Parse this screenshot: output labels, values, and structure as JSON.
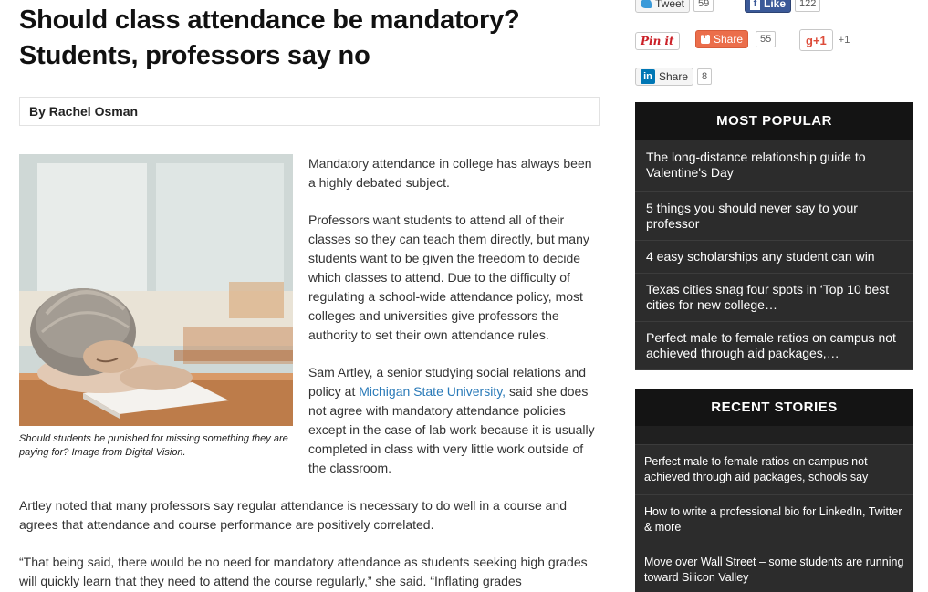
{
  "article": {
    "headline": "Should class attendance be mandatory? Students, professors say no",
    "byline": "By Rachel Osman",
    "image_caption": "Should students be punished for missing something they are paying for? Image from Digital Vision.",
    "paragraphs": {
      "p1": "Mandatory attendance in college has always been a highly debated subject.",
      "p2": "Professors want students to attend all of their classes so they can teach them directly, but many students want to be given the freedom to decide which classes to attend. Due to the difficulty of regulating a school-wide attendance policy, most colleges and universities give professors the authority to set their own attendance rules.",
      "p3_before": "Sam Artley, a senior studying social relations and policy at ",
      "p3_link": "Michigan State University,",
      "p3_after": " said she does not agree with mandatory attendance policies except in the case of lab work because it is usually completed in class with very little work outside of the classroom.",
      "p4": "Artley noted that many professors say regular attendance is necessary to do well in a course and agrees that attendance and course performance are positively correlated.",
      "p5": "“That being said, there would be no need for mandatory attendance as students seeking high grades will quickly learn that they need to attend the course regularly,” she said. “Inflating grades"
    }
  },
  "share": {
    "tweet_label": "Tweet",
    "tweet_count": "59",
    "fb_label": "Like",
    "fb_count": "122",
    "pin_label": "Pin it",
    "stumble_label": "Share",
    "stumble_count": "55",
    "gplus_label": "g+1",
    "gplus_count": "+1",
    "linkedin_label": "Share",
    "linkedin_count": "8",
    "linkedin_logo": "in",
    "fb_logo": "f"
  },
  "sidebar": {
    "most_popular_title": "MOST POPULAR",
    "most_popular": [
      "The long-distance relationship guide to Valentine's Day",
      "5 things you should never say to your professor",
      "4 easy scholarships any student can win",
      "Texas cities snag four spots in ‘Top 10 best cities for new college…",
      "Perfect male to female ratios on campus not achieved through aid packages,…"
    ],
    "recent_title": "RECENT STORIES",
    "recent": [
      "Perfect male to female ratios on campus not achieved through aid packages, schools say",
      "How to write a professional bio for LinkedIn, Twitter & more",
      "Move over Wall Street – some students are running toward Silicon Valley"
    ]
  },
  "icons": {
    "twitter": "twitter-bird-icon",
    "facebook": "facebook-icon",
    "pinterest": "pinterest-icon",
    "stumbleupon": "stumbleupon-icon",
    "googleplus": "google-plus-icon",
    "linkedin": "linkedin-icon"
  },
  "colors": {
    "sidebar_bg": "#202020",
    "sidebar_head": "#141414",
    "link": "#2a7ab8"
  }
}
